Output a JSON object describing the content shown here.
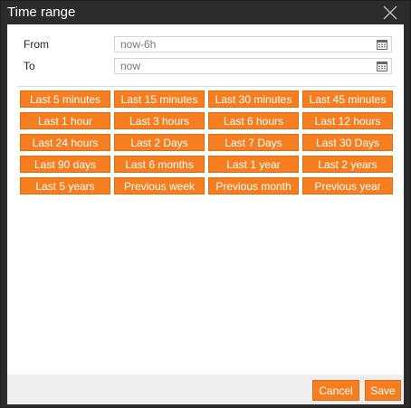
{
  "dialog": {
    "title": "Time range",
    "close_icon": "close-icon"
  },
  "from": {
    "label": "From",
    "value": "now-6h",
    "icon": "calendar-icon"
  },
  "to": {
    "label": "To",
    "value": "now",
    "icon": "calendar-icon"
  },
  "quick_ranges": [
    "Last 5 minutes",
    "Last 15 minutes",
    "Last 30 minutes",
    "Last 45 minutes",
    "Last 1 hour",
    "Last 3 hours",
    "Last 6 hours",
    "Last 12 hours",
    "Last 24 hours",
    "Last 2 Days",
    "Last 7 Days",
    "Last 30 Days",
    "Last 90 days",
    "Last 6 months",
    "Last 1 year",
    "Last 2 years",
    "Last 5 years",
    "Previous week",
    "Previous month",
    "Previous year"
  ],
  "footer": {
    "cancel_label": "Cancel",
    "save_label": "Save"
  },
  "colors": {
    "accent": "#f57f20",
    "titlebar": "#2b2b2b",
    "footer": "#eeeeee"
  }
}
